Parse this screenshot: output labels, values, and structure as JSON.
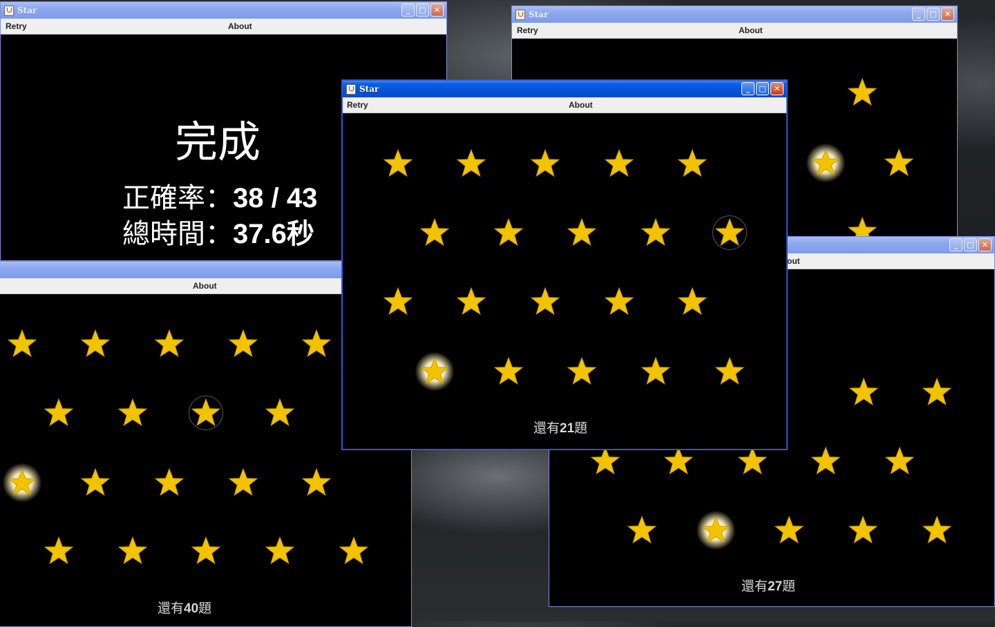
{
  "app_title": "Star",
  "menu": {
    "retry": "Retry",
    "about": "About"
  },
  "result": {
    "done": "完成",
    "accuracy_label": "正確率：",
    "accuracy_value": "38 / 43",
    "time_label": "總時間：",
    "time_value": "37.6秒"
  },
  "windows": {
    "front": {
      "remaining_prefix": "還有",
      "remaining_count": "21",
      "remaining_suffix": "題"
    },
    "bottom_left": {
      "remaining_prefix": "還有",
      "remaining_count": "40",
      "remaining_suffix": "題"
    },
    "bottom_right": {
      "remaining_prefix": "還有",
      "remaining_count": "27",
      "remaining_suffix": "題"
    }
  },
  "colors": {
    "star": "#f2c300",
    "star_stroke": "#c99a00",
    "titlebar_active": "#0553d6",
    "titlebar_inactive": "#8da8ee"
  }
}
